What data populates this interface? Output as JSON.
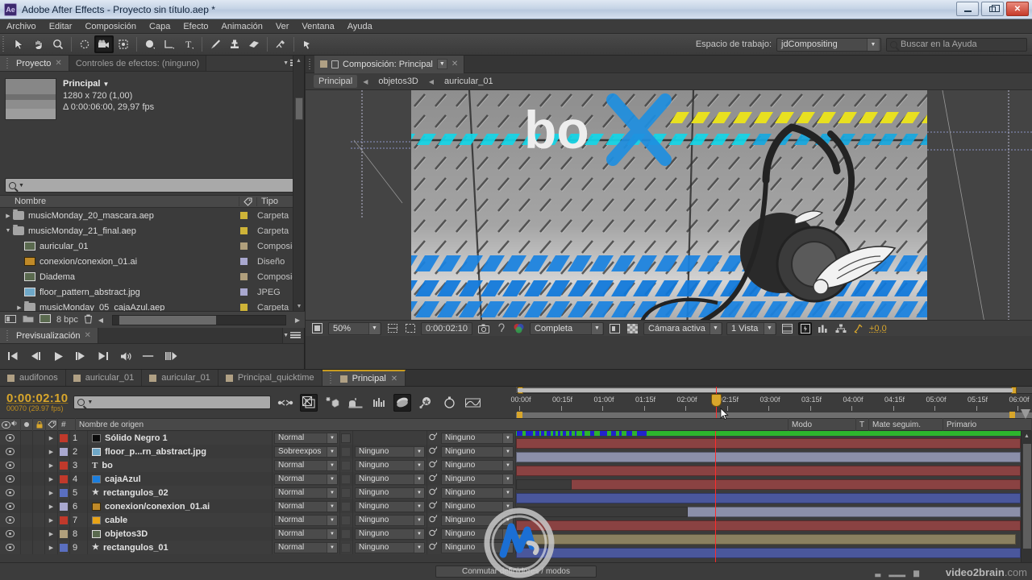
{
  "titlebar": {
    "logo": "Ae",
    "title": "Adobe After Effects - Proyecto sin título.aep *",
    "minimize": "–",
    "maximize": "❐",
    "close": "✕"
  },
  "menubar": {
    "items": [
      "Archivo",
      "Editar",
      "Composición",
      "Capa",
      "Efecto",
      "Animación",
      "Ver",
      "Ventana",
      "Ayuda"
    ]
  },
  "toolbar": {
    "workspace_label": "Espacio de trabajo:",
    "workspace_value": "jdCompositing",
    "help_placeholder": "Buscar en la Ayuda",
    "tools": [
      {
        "name": "selection-tool",
        "glyph": "➤"
      },
      {
        "name": "hand-tool",
        "glyph": "✋"
      },
      {
        "name": "zoom-tool",
        "glyph": "🔍"
      },
      {
        "name": "rotation-tool",
        "glyph": "↻"
      },
      {
        "name": "camera-tool",
        "glyph": "🎥"
      },
      {
        "name": "pan-behind-tool",
        "glyph": "⬚"
      },
      {
        "name": "shape-tool",
        "glyph": "●"
      },
      {
        "name": "pen-tool",
        "glyph": "✎"
      },
      {
        "name": "text-tool",
        "glyph": "T"
      },
      {
        "name": "brush-tool",
        "glyph": "🖌"
      },
      {
        "name": "clone-stamp-tool",
        "glyph": "⚲"
      },
      {
        "name": "eraser-tool",
        "glyph": "▰"
      },
      {
        "name": "roto-brush-tool",
        "glyph": "⌁"
      },
      {
        "name": "puppet-pin-tool",
        "glyph": "📌"
      }
    ]
  },
  "project": {
    "tab_label": "Proyecto",
    "effects_tab_label": "Controles de efectos: (ninguno)",
    "comp_name": "Principal",
    "comp_size": "1280 x 720 (1,00)",
    "comp_duration": "Δ 0:00:06:00, 29,97 fps",
    "columns": {
      "name": "Nombre",
      "type": "Tipo"
    },
    "items": [
      {
        "name": "musicMonday_20_mascara.aep",
        "type": "Carpeta",
        "icon": "folder-icon",
        "swatch": "#cfb438",
        "indent": 0,
        "twisty": "▶"
      },
      {
        "name": "musicMonday_21_final.aep",
        "type": "Carpeta",
        "icon": "folder-icon",
        "swatch": "#cfb438",
        "indent": 0,
        "twisty": "▼"
      },
      {
        "name": "auricular_01",
        "type": "Composición",
        "icon": "comp-icon",
        "swatch": "#b09f7c",
        "indent": 1,
        "twisty": ""
      },
      {
        "name": "conexion/conexion_01.ai",
        "type": "Diseño",
        "icon": "ai-icon",
        "swatch": "#a9a8cf",
        "indent": 1,
        "twisty": ""
      },
      {
        "name": "Diadema",
        "type": "Composición",
        "icon": "comp-icon",
        "swatch": "#b09f7c",
        "indent": 1,
        "twisty": ""
      },
      {
        "name": "floor_pattern_abstract.jpg",
        "type": "JPEG",
        "icon": "jpeg-icon",
        "swatch": "#a9a8cf",
        "indent": 1,
        "twisty": ""
      },
      {
        "name": "musicMonday_05_cajaAzul.aep",
        "type": "Carpeta",
        "icon": "folder-icon",
        "swatch": "#cfb438",
        "indent": 1,
        "twisty": "▶"
      }
    ],
    "footer_bpc": "8 bpc"
  },
  "preview": {
    "tab_label": "Previsualización",
    "buttons": [
      {
        "name": "first-frame-button",
        "glyph": "|◀"
      },
      {
        "name": "previous-frame-button",
        "glyph": "◀|"
      },
      {
        "name": "play-button",
        "glyph": "▶"
      },
      {
        "name": "next-frame-button",
        "glyph": "|▶"
      },
      {
        "name": "last-frame-button",
        "glyph": "▶|"
      },
      {
        "name": "audio-button",
        "glyph": "🔊"
      },
      {
        "name": "loop-button",
        "glyph": "—"
      },
      {
        "name": "ram-preview-button",
        "glyph": "⦀▶"
      }
    ]
  },
  "composition": {
    "tab_label": "Composición: Principal",
    "breadcrumb": [
      "Principal",
      "objetos3D",
      "auricular_01"
    ],
    "text_overlay": "bo",
    "toolbar": {
      "zoom": "50%",
      "timecode": "0:00:02:10",
      "resolution": "Completa",
      "camera": "Cámara activa",
      "views": "1 Vista",
      "exposure": "+0,0"
    }
  },
  "timeline": {
    "tabs": [
      {
        "label": "audifonos",
        "active": false
      },
      {
        "label": "auricular_01",
        "active": false
      },
      {
        "label": "auricular_01",
        "active": false
      },
      {
        "label": "Principal_quicktime",
        "active": false
      },
      {
        "label": "Principal",
        "active": true
      }
    ],
    "current_time": "0:00:02:10",
    "frame_info": "00070 (29.97 fps)",
    "columns": {
      "source_name": "Nombre de origen",
      "mode": "Modo",
      "t": "T",
      "track_matte": "Mate seguim.",
      "parent": "Primario",
      "number": "#"
    },
    "ruler_ticks": [
      "00:00f",
      "00:15f",
      "01:00f",
      "01:15f",
      "02:00f",
      "02:15f",
      "03:00f",
      "03:15f",
      "04:00f",
      "04:15f",
      "05:00f",
      "05:15f",
      "06:00f"
    ],
    "layers": [
      {
        "num": "1",
        "name": "Sólido Negro 1",
        "mode": "Normal",
        "matte": "",
        "parent": "Ninguno",
        "color": "#c0392b",
        "icon": "solid-icon",
        "icon_color": "#0b0b0b",
        "bar_color": "#8a4242",
        "bar_start": 0,
        "bar_end": 100,
        "trim_start": 0
      },
      {
        "num": "2",
        "name": "floor_p...rn_abstract.jpg",
        "mode": "Sobreexpos",
        "matte": "Ninguno",
        "parent": "Ninguno",
        "color": "#a9a8cf",
        "icon": "jpeg-icon",
        "icon_color": "#6fa8c8",
        "bar_color": "#8b8fa9",
        "bar_start": 0,
        "bar_end": 100,
        "trim_start": 0
      },
      {
        "num": "3",
        "name": "bo",
        "mode": "Normal",
        "matte": "Ninguno",
        "parent": "Ninguno",
        "color": "#c0392b",
        "icon": "text-icon",
        "icon_color": "#d8d8d8",
        "bar_color": "#8a4242",
        "bar_start": 0,
        "bar_end": 100,
        "trim_start": 0
      },
      {
        "num": "4",
        "name": "cajaAzul",
        "mode": "Normal",
        "matte": "Ninguno",
        "parent": "Ninguno",
        "color": "#c0392b",
        "icon": "solid-icon",
        "icon_color": "#1b7fe0",
        "bar_color": "#8a4242",
        "bar_start": 0,
        "bar_end": 100,
        "trim_start": 11
      },
      {
        "num": "5",
        "name": "rectangulos_02",
        "mode": "Normal",
        "matte": "Ninguno",
        "parent": "Ninguno",
        "color": "#5a6fc0",
        "icon": "shape-icon",
        "icon_color": "#d8d8d8",
        "bar_color": "#4a579c",
        "bar_start": 0,
        "bar_end": 100,
        "trim_start": 0
      },
      {
        "num": "6",
        "name": "conexion/conexion_01.ai",
        "mode": "Normal",
        "matte": "Ninguno",
        "parent": "Ninguno",
        "color": "#a9a8cf",
        "icon": "ai-icon",
        "icon_color": "#c08a28",
        "bar_color": "#8b8fa9",
        "bar_start": 0,
        "bar_end": 100,
        "trim_start": 34
      },
      {
        "num": "7",
        "name": "cable",
        "mode": "Normal",
        "matte": "Ninguno",
        "parent": "Ninguno",
        "color": "#c0392b",
        "icon": "solid-icon",
        "icon_color": "#e8a317",
        "bar_color": "#8a4242",
        "bar_start": 0,
        "bar_end": 100,
        "trim_start": 0
      },
      {
        "num": "8",
        "name": "objetos3D",
        "mode": "Normal",
        "matte": "Ninguno",
        "parent": "Ninguno",
        "color": "#b09f7c",
        "icon": "comp-icon",
        "icon_color": "#5a6a4f",
        "bar_color": "#8a8060",
        "bar_start": 0,
        "bar_end": 99,
        "trim_start": 0
      },
      {
        "num": "9",
        "name": "rectangulos_01",
        "mode": "Normal",
        "matte": "Ninguno",
        "parent": "Ninguno",
        "color": "#5a6fc0",
        "icon": "shape-icon",
        "icon_color": "#d8d8d8",
        "bar_color": "#4a579c",
        "bar_start": 0,
        "bar_end": 100,
        "trim_start": 0
      }
    ],
    "playhead_percent": 39.5,
    "toggle_button": "Conmutar definidores / modos"
  },
  "branding": {
    "name": "video2brain",
    "tld": ".com"
  }
}
